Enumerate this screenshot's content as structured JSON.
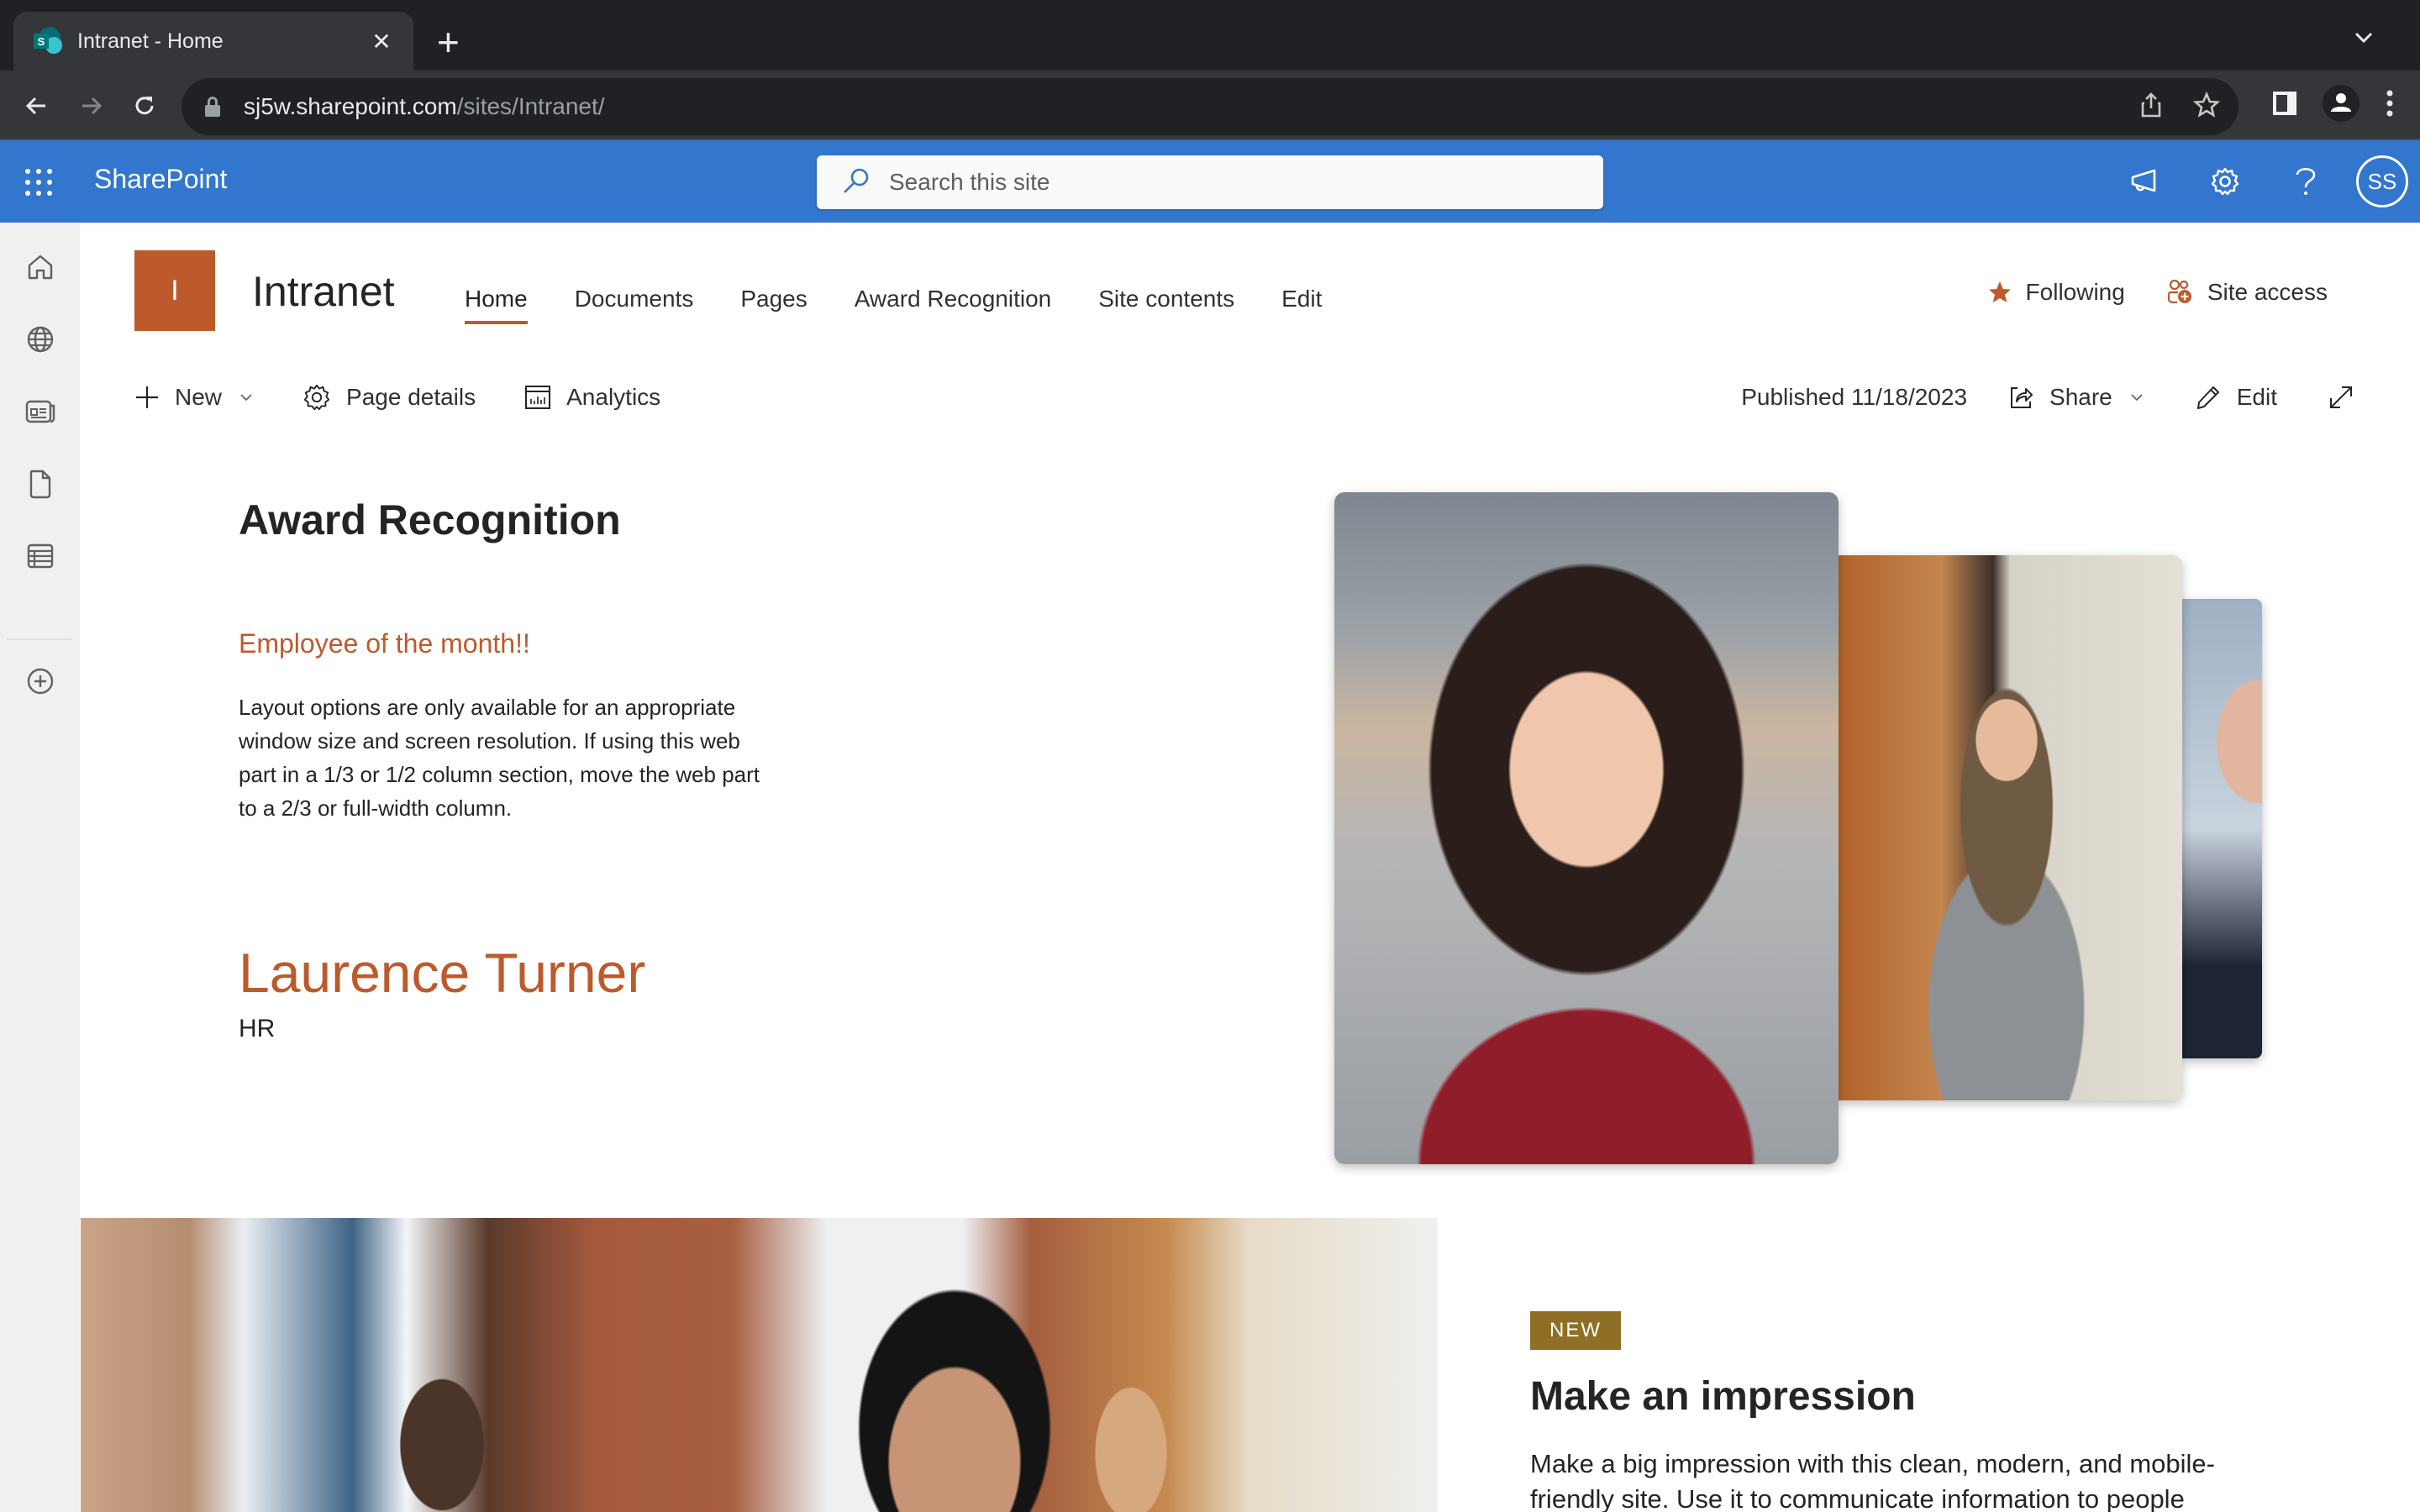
{
  "browser": {
    "tab_title": "Intranet - Home",
    "url_host": "sj5w.sharepoint.com",
    "url_path": "/sites/Intranet/"
  },
  "suitebar": {
    "brand": "SharePoint",
    "search_placeholder": "Search this site",
    "avatar_initials": "SS",
    "color": "#3376cd"
  },
  "rail": {
    "items": [
      {
        "icon": "home-icon"
      },
      {
        "icon": "globe-icon"
      },
      {
        "icon": "news-icon"
      },
      {
        "icon": "document-icon"
      },
      {
        "icon": "list-icon"
      },
      {
        "icon": "add-circle-icon"
      }
    ]
  },
  "site": {
    "logo_letter": "I",
    "title": "Intranet",
    "accent_color": "#bd5a2c",
    "nav": [
      {
        "label": "Home",
        "active": true
      },
      {
        "label": "Documents"
      },
      {
        "label": "Pages"
      },
      {
        "label": "Award Recognition"
      },
      {
        "label": "Site contents"
      },
      {
        "label": "Edit"
      }
    ],
    "following_label": "Following",
    "site_access_label": "Site access"
  },
  "commandbar": {
    "new_label": "New",
    "page_details_label": "Page details",
    "analytics_label": "Analytics",
    "published": "Published 11/18/2023",
    "share_label": "Share",
    "edit_label": "Edit"
  },
  "award": {
    "title": "Award Recognition",
    "subtitle": "Employee of the month!!",
    "description": "Layout options are only available for an appropriate window size and screen resolution. If using this web part in a 1/3 or 1/2 column section, move the web part to a 2/3 or full-width column.",
    "employee_name": "Laurence Turner",
    "employee_department": "HR"
  },
  "hero": {
    "badge": "NEW",
    "badge_color": "#8f6f25",
    "title": "Make an impression",
    "description": "Make a big impression with this clean, modern, and mobile-friendly site. Use it to communicate information to people"
  }
}
